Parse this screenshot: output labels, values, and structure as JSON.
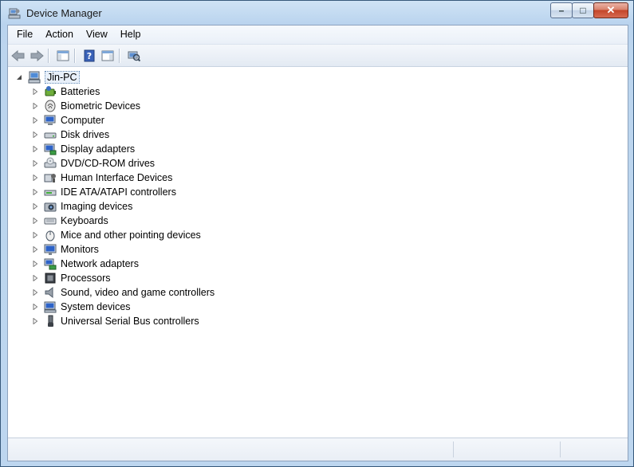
{
  "window": {
    "title": "Device Manager",
    "minimize": "–",
    "maximize": "□",
    "close": "✕"
  },
  "menu": [
    "File",
    "Action",
    "View",
    "Help"
  ],
  "toolbar": [
    "back-arrow-icon",
    "forward-arrow-icon",
    "show-hide-console-tree-icon",
    "help-icon",
    "properties-pane-icon",
    "scan-hardware-icon"
  ],
  "tree": {
    "root": "Jin-PC",
    "items": [
      {
        "label": "Batteries",
        "icon": "battery-icon"
      },
      {
        "label": "Biometric Devices",
        "icon": "fingerprint-icon"
      },
      {
        "label": "Computer",
        "icon": "computer-icon"
      },
      {
        "label": "Disk drives",
        "icon": "disk-drive-icon"
      },
      {
        "label": "Display adapters",
        "icon": "display-adapter-icon"
      },
      {
        "label": "DVD/CD-ROM drives",
        "icon": "dvd-drive-icon"
      },
      {
        "label": "Human Interface Devices",
        "icon": "hid-icon"
      },
      {
        "label": "IDE ATA/ATAPI controllers",
        "icon": "ide-controller-icon"
      },
      {
        "label": "Imaging devices",
        "icon": "camera-icon"
      },
      {
        "label": "Keyboards",
        "icon": "keyboard-icon"
      },
      {
        "label": "Mice and other pointing devices",
        "icon": "mouse-icon"
      },
      {
        "label": "Monitors",
        "icon": "monitor-icon"
      },
      {
        "label": "Network adapters",
        "icon": "network-adapter-icon"
      },
      {
        "label": "Processors",
        "icon": "processor-icon"
      },
      {
        "label": "Sound, video and game controllers",
        "icon": "speaker-icon"
      },
      {
        "label": "System devices",
        "icon": "system-devices-icon"
      },
      {
        "label": "Universal Serial Bus controllers",
        "icon": "usb-icon"
      }
    ]
  }
}
